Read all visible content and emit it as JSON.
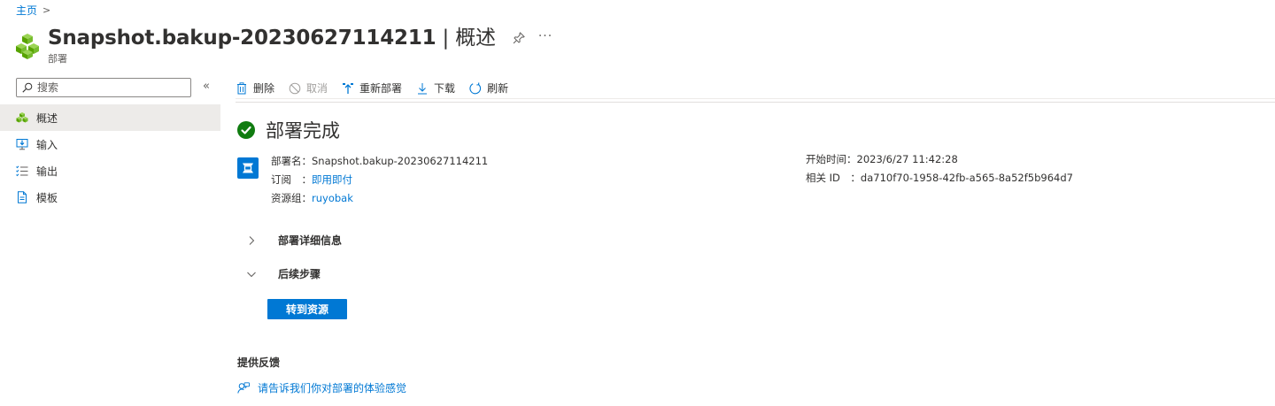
{
  "breadcrumb": {
    "home": "主页",
    "separator": ">"
  },
  "header": {
    "title_main": "Snapshot.bakup-20230627114211",
    "title_sep": " | ",
    "title_section": "概述",
    "subtitle": "部署",
    "more": "···",
    "icon": "deployment-cubes-icon"
  },
  "sidebar": {
    "search_placeholder": "搜索",
    "collapse": "«",
    "items": [
      {
        "label": "概述",
        "icon": "deployment-cubes-icon",
        "active": true
      },
      {
        "label": "输入",
        "icon": "input-monitor-icon",
        "active": false
      },
      {
        "label": "输出",
        "icon": "output-list-icon",
        "active": false
      },
      {
        "label": "模板",
        "icon": "template-document-icon",
        "active": false
      }
    ]
  },
  "toolbar": {
    "delete": "删除",
    "cancel": "取消",
    "redeploy": "重新部署",
    "download": "下载",
    "refresh": "刷新"
  },
  "status": {
    "text": "部署完成",
    "color": "#107c10"
  },
  "details_left": {
    "name_label": "部署名：",
    "name_value": "Snapshot.bakup-20230627114211",
    "subscription_label": "订阅　：",
    "subscription_value": "即用即付",
    "resource_group_label": "资源组：",
    "resource_group_value": "ruyobak"
  },
  "details_right": {
    "start_time_label": "开始时间：",
    "start_time_value": "2023/6/27 11:42:28",
    "correlation_label": "相关 ID　：",
    "correlation_value": "da710f70-1958-42fb-a565-8a52f5b964d7"
  },
  "sections": {
    "deployment_details": "部署详细信息",
    "next_steps": "后续步骤"
  },
  "go_to_resource": "转到资源",
  "feedback": {
    "title": "提供反馈",
    "link": "请告诉我们你对部署的体验感觉"
  },
  "colors": {
    "accent": "#0078d4",
    "success": "#107c10",
    "active_bg": "#edebe9"
  }
}
